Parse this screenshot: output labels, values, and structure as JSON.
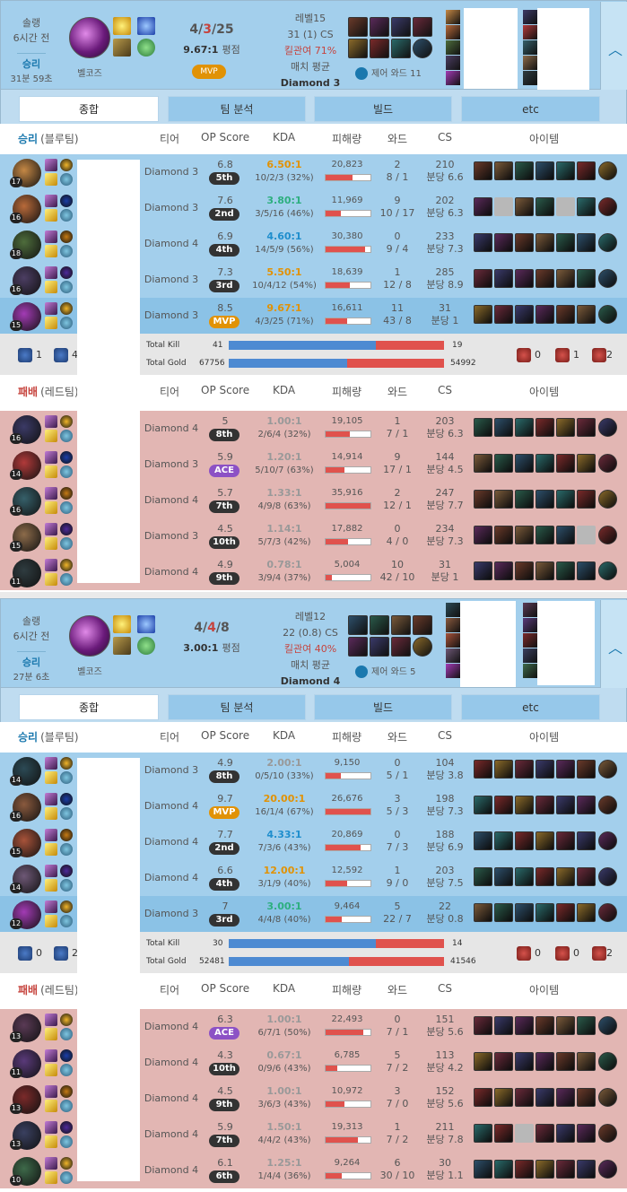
{
  "games": [
    {
      "type": "솔랭",
      "ago": "6시간 전",
      "result": "승리",
      "duration": "31분 59초",
      "champion": "벨코즈",
      "kda": {
        "k": "4",
        "d": "3",
        "a": "25",
        "sep": "/"
      },
      "kda_ratio": "9.67:1",
      "kda_ratio_suffix": "평점",
      "badge": "MVP",
      "level": "레벨15",
      "cs": "31 (1) CS",
      "kill_participation": "킬관여 71%",
      "avg_label": "매치 평균",
      "avg_tier": "Diamond 3",
      "control_ward": "제어 와드 11",
      "tabs": [
        "종합",
        "팀 분석",
        "빌드",
        "etc"
      ],
      "headers": {
        "tier": "티어",
        "score": "OP Score",
        "kda": "KDA",
        "damage": "피해량",
        "ward": "와드",
        "cs": "CS",
        "items": "아이템"
      },
      "blue_label": "승리",
      "blue_team": "(블루팀)",
      "red_label": "패배",
      "red_team": "(레드팀)",
      "blue_players": [
        {
          "level": "17",
          "tier": "Diamond 3",
          "score": "6.8",
          "rank": "5th",
          "kr": "6.50:1",
          "kd": "10/2/3 (32%)",
          "dmg": "20,823",
          "dmg_pct": 0.6,
          "wards": "2",
          "wards2": "8 / 1",
          "cs": "210",
          "cspm": "분당 6.6",
          "col": "#c58845"
        },
        {
          "level": "16",
          "tier": "Diamond 3",
          "score": "7.6",
          "rank": "2nd",
          "kr": "3.80:1",
          "kd": "3/5/16 (46%)",
          "dmg": "11,969",
          "dmg_pct": 0.34,
          "wards": "9",
          "wards2": "10 / 17",
          "cs": "202",
          "cspm": "분당 6.3",
          "col": "#b86a3a"
        },
        {
          "level": "18",
          "tier": "Diamond 4",
          "score": "6.9",
          "rank": "4th",
          "kr": "4.60:1",
          "kd": "14/5/9 (56%)",
          "dmg": "30,380",
          "dmg_pct": 0.87,
          "wards": "0",
          "wards2": "9 / 4",
          "cs": "233",
          "cspm": "분당 7.3",
          "col": "#4e6d3c"
        },
        {
          "level": "16",
          "tier": "Diamond 3",
          "score": "7.3",
          "rank": "3rd",
          "kr": "5.50:1",
          "kd": "10/4/12 (54%)",
          "dmg": "18,639",
          "dmg_pct": 0.53,
          "wards": "1",
          "wards2": "12 / 8",
          "cs": "285",
          "cspm": "분당 8.9",
          "col": "#4c3e63"
        },
        {
          "level": "15",
          "tier": "Diamond 3",
          "score": "8.5",
          "rank": "MVP",
          "kr": "9.67:1",
          "kd": "4/3/25 (71%)",
          "dmg": "16,611",
          "dmg_pct": 0.47,
          "wards": "11",
          "wards2": "43 / 8",
          "cs": "31",
          "cspm": "분당 1",
          "col": "#a33bb5",
          "me": true
        }
      ],
      "red_players": [
        {
          "level": "16",
          "tier": "Diamond 4",
          "score": "5",
          "rank": "8th",
          "kr": "1.00:1",
          "kd": "2/6/4 (32%)",
          "dmg": "19,105",
          "dmg_pct": 0.53,
          "wards": "1",
          "wards2": "7 / 1",
          "cs": "203",
          "cspm": "분당 6.3",
          "col": "#3b3a66"
        },
        {
          "level": "14",
          "tier": "Diamond 3",
          "score": "5.9",
          "rank": "ACE",
          "kr": "1.20:1",
          "kd": "5/10/7 (63%)",
          "dmg": "14,914",
          "dmg_pct": 0.42,
          "wards": "9",
          "wards2": "17 / 1",
          "cs": "144",
          "cspm": "분당 4.5",
          "col": "#b13a3a"
        },
        {
          "level": "16",
          "tier": "Diamond 4",
          "score": "5.7",
          "rank": "7th",
          "kr": "1.33:1",
          "kd": "4/9/8 (63%)",
          "dmg": "35,916",
          "dmg_pct": 1.0,
          "wards": "2",
          "wards2": "12 / 1",
          "cs": "247",
          "cspm": "분당 7.7",
          "col": "#36606a"
        },
        {
          "level": "15",
          "tier": "Diamond 3",
          "score": "4.5",
          "rank": "10th",
          "kr": "1.14:1",
          "kd": "5/7/3 (42%)",
          "dmg": "17,882",
          "dmg_pct": 0.5,
          "wards": "0",
          "wards2": "4 / 0",
          "cs": "234",
          "cspm": "분당 7.3",
          "col": "#8c6b4a"
        },
        {
          "level": "11",
          "tier": "Diamond 4",
          "score": "4.9",
          "rank": "9th",
          "kr": "0.78:1",
          "kd": "3/9/4 (37%)",
          "dmg": "5,004",
          "dmg_pct": 0.14,
          "wards": "10",
          "wards2": "42 / 10",
          "cs": "31",
          "cspm": "분당 1",
          "col": "#2f3c40"
        }
      ],
      "obj_blue": {
        "baron": "1",
        "dragon": "4"
      },
      "obj_red": {
        "tower": "0",
        "baron": "1",
        "dragon": "2"
      },
      "total_kill_label": "Total Kill",
      "total_gold_label": "Total Gold",
      "kill_blue": "41",
      "kill_red": "19",
      "kill_frac": 0.683,
      "gold_blue": "67756",
      "gold_red": "54992",
      "gold_frac": 0.552
    },
    {
      "type": "솔랭",
      "ago": "6시간 전",
      "result": "승리",
      "duration": "27분 6초",
      "champion": "벨코즈",
      "kda": {
        "k": "4",
        "d": "4",
        "a": "8",
        "sep": "/"
      },
      "kda_ratio": "3.00:1",
      "kda_ratio_suffix": "평점",
      "badge": "",
      "level": "레벨12",
      "cs": "22 (0.8) CS",
      "kill_participation": "킬관여 40%",
      "avg_label": "매치 평균",
      "avg_tier": "Diamond 4",
      "control_ward": "제어 와드 5",
      "tabs": [
        "종합",
        "팀 분석",
        "빌드",
        "etc"
      ],
      "headers": {
        "tier": "티어",
        "score": "OP Score",
        "kda": "KDA",
        "damage": "피해량",
        "ward": "와드",
        "cs": "CS",
        "items": "아이템"
      },
      "blue_label": "승리",
      "blue_team": "(블루팀)",
      "red_label": "패배",
      "red_team": "(레드팀)",
      "blue_players": [
        {
          "level": "14",
          "tier": "Diamond 3",
          "score": "4.9",
          "rank": "8th",
          "kr": "2.00:1",
          "kd": "0/5/10 (33%)",
          "dmg": "9,150",
          "dmg_pct": 0.34,
          "wards": "0",
          "wards2": "5 / 1",
          "cs": "104",
          "cspm": "분당 3.8",
          "col": "#2c4a55"
        },
        {
          "level": "16",
          "tier": "Diamond 4",
          "score": "9.7",
          "rank": "MVP",
          "kr": "20.00:1",
          "kd": "16/1/4 (67%)",
          "dmg": "26,676",
          "dmg_pct": 1.0,
          "wards": "3",
          "wards2": "5 / 3",
          "cs": "198",
          "cspm": "분당 7.3",
          "col": "#8a5a3e"
        },
        {
          "level": "15",
          "tier": "Diamond 4",
          "score": "7.7",
          "rank": "2nd",
          "kr": "4.33:1",
          "kd": "7/3/6 (43%)",
          "dmg": "20,869",
          "dmg_pct": 0.78,
          "wards": "0",
          "wards2": "7 / 3",
          "cs": "188",
          "cspm": "분당 6.9",
          "col": "#a8533a"
        },
        {
          "level": "14",
          "tier": "Diamond 4",
          "score": "6.6",
          "rank": "4th",
          "kr": "12.00:1",
          "kd": "3/1/9 (40%)",
          "dmg": "12,592",
          "dmg_pct": 0.47,
          "wards": "1",
          "wards2": "9 / 0",
          "cs": "203",
          "cspm": "분당 7.5",
          "col": "#6e5876"
        },
        {
          "level": "12",
          "tier": "Diamond 3",
          "score": "7",
          "rank": "3rd",
          "kr": "3.00:1",
          "kd": "4/4/8 (40%)",
          "dmg": "9,464",
          "dmg_pct": 0.35,
          "wards": "5",
          "wards2": "22 / 7",
          "cs": "22",
          "cspm": "분당 0.8",
          "col": "#a33bb5",
          "me": true
        }
      ],
      "red_players": [
        {
          "level": "13",
          "tier": "Diamond 4",
          "score": "6.3",
          "rank": "ACE",
          "kr": "1.00:1",
          "kd": "6/7/1 (50%)",
          "dmg": "22,493",
          "dmg_pct": 0.84,
          "wards": "0",
          "wards2": "7 / 1",
          "cs": "151",
          "cspm": "분당 5.6",
          "col": "#5a3a55"
        },
        {
          "level": "11",
          "tier": "Diamond 4",
          "score": "4.3",
          "rank": "10th",
          "kr": "0.67:1",
          "kd": "0/9/6 (43%)",
          "dmg": "6,785",
          "dmg_pct": 0.25,
          "wards": "5",
          "wards2": "7 / 2",
          "cs": "113",
          "cspm": "분당 4.2",
          "col": "#5a3a7a"
        },
        {
          "level": "13",
          "tier": "Diamond 4",
          "score": "4.5",
          "rank": "9th",
          "kr": "1.00:1",
          "kd": "3/6/3 (43%)",
          "dmg": "10,972",
          "dmg_pct": 0.41,
          "wards": "3",
          "wards2": "7 / 0",
          "cs": "152",
          "cspm": "분당 5.6",
          "col": "#7b2a2a"
        },
        {
          "level": "13",
          "tier": "Diamond 4",
          "score": "5.9",
          "rank": "7th",
          "kr": "1.50:1",
          "kd": "4/4/2 (43%)",
          "dmg": "19,313",
          "dmg_pct": 0.72,
          "wards": "1",
          "wards2": "7 / 2",
          "cs": "211",
          "cspm": "분당 7.8",
          "col": "#3a4060"
        },
        {
          "level": "10",
          "tier": "Diamond 4",
          "score": "6.1",
          "rank": "6th",
          "kr": "1.25:1",
          "kd": "1/4/4 (36%)",
          "dmg": "9,264",
          "dmg_pct": 0.35,
          "wards": "6",
          "wards2": "30 / 10",
          "cs": "30",
          "cspm": "분당 1.1",
          "col": "#3e6a4a"
        }
      ],
      "obj_blue": {
        "baron": "0",
        "dragon": "2"
      },
      "obj_red": {
        "tower": "0",
        "baron": "0",
        "dragon": "2"
      },
      "total_kill_label": "Total Kill",
      "total_gold_label": "Total Gold",
      "kill_blue": "30",
      "kill_red": "14",
      "kill_frac": 0.682,
      "gold_blue": "52481",
      "gold_red": "41546",
      "gold_frac": 0.558
    }
  ],
  "colors": {
    "win": "#1a78ae",
    "lose": "#c6443e",
    "blue_bg": "#a3cfec",
    "red_bg": "#e2b6b3",
    "mvp": "#e19205",
    "ace": "#8c51c5",
    "kr_gold": "#e19205",
    "kr_blue": "#1f8ecd",
    "kr_teal": "#2daf7f",
    "kr_gray": "#999999"
  },
  "icons": {
    "expand": "chevron-up-icon",
    "ward": "ward-icon",
    "baron": "baron-icon",
    "dragon": "dragon-icon",
    "tower": "tower-icon"
  }
}
